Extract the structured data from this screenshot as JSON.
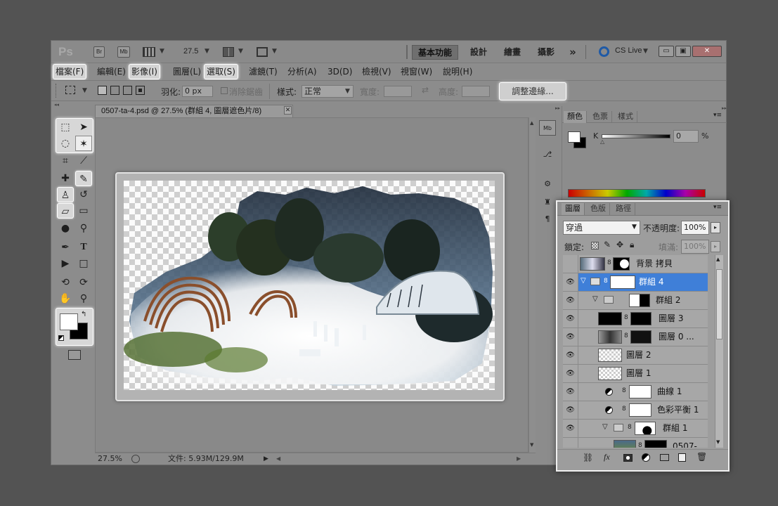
{
  "app": {
    "logo": "Ps",
    "btn_br": "Br",
    "btn_mb": "Mb",
    "zoom": "27.5",
    "workspaces": [
      "基本功能",
      "設計",
      "繪畫",
      "攝影"
    ],
    "more": "»",
    "cs_live": "CS Live",
    "cs_live_icon": "cs-live-icon",
    "win_minimize": "▭",
    "win_restore": "▣",
    "win_close": "✕"
  },
  "menu": [
    "檔案(F)",
    "編輯(E)",
    "影像(I)",
    "圖層(L)",
    "選取(S)",
    "濾鏡(T)",
    "分析(A)",
    "3D(D)",
    "檢視(V)",
    "視窗(W)",
    "說明(H)"
  ],
  "options": {
    "feather_label": "羽化:",
    "feather_value": "0 px",
    "antialias_label": "消除鋸齒",
    "style_label": "樣式:",
    "style_value": "正常",
    "width_label": "寬度:",
    "height_label": "高度:",
    "refine_edge": "調整邊緣..."
  },
  "document": {
    "tab_title": "0507-ta-4.psd @ 27.5% (群組 4, 圖層遮色片/8)",
    "tab_close": "✕",
    "status_zoom": "27.5%",
    "status_file": "文件: 5.93M/129.9M"
  },
  "color_panel": {
    "tabs": [
      "顏色",
      "色票",
      "樣式"
    ],
    "channel": "K",
    "value": "0",
    "unit": "%"
  },
  "layers_panel": {
    "tabs": [
      "圖層",
      "色版",
      "路徑"
    ],
    "blend_mode": "穿過",
    "opacity_label": "不透明度:",
    "opacity_value": "100%",
    "lock_label": "鎖定:",
    "fill_label": "填滿:",
    "fill_value": "100%",
    "rows": [
      {
        "name": "背景 拷貝",
        "visible": false,
        "selected": false
      },
      {
        "name": "群組 4",
        "visible": true,
        "selected": true
      },
      {
        "name": "群組 2",
        "visible": true,
        "selected": false
      },
      {
        "name": "圖層 3",
        "visible": true,
        "selected": false
      },
      {
        "name": "圖層 0 ...",
        "visible": true,
        "selected": false
      },
      {
        "name": "圖層 2",
        "visible": true,
        "selected": false
      },
      {
        "name": "圖層 1",
        "visible": true,
        "selected": false
      },
      {
        "name": "曲線 1",
        "visible": true,
        "selected": false
      },
      {
        "name": "色彩平衡 1",
        "visible": true,
        "selected": false
      },
      {
        "name": "群組 1",
        "visible": true,
        "selected": false
      },
      {
        "name": "0507-...",
        "visible": false,
        "selected": false
      }
    ],
    "footer_icons": [
      "link-icon",
      "fx-icon",
      "mask-icon",
      "adjustment-icon",
      "group-icon",
      "new-layer-icon",
      "trash-icon"
    ]
  }
}
